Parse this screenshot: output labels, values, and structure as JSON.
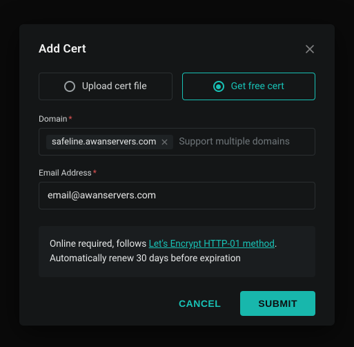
{
  "modal": {
    "title": "Add Cert",
    "options": {
      "upload": {
        "label": "Upload cert file"
      },
      "free": {
        "label": "Get free cert"
      }
    },
    "fields": {
      "domain": {
        "label": "Domain",
        "chips": [
          "safeline.awanservers.com"
        ],
        "placeholder": "Support multiple domains"
      },
      "email": {
        "label": "Email Address",
        "value": "email@awanservers.com"
      }
    },
    "notice": {
      "pre": "Online required, follows ",
      "link_text": "Let's Encrypt HTTP-01 method",
      "post1": ". ",
      "post2": "Automatically renew 30 days before expiration"
    },
    "actions": {
      "cancel": "CANCEL",
      "submit": "SUBMIT"
    }
  }
}
